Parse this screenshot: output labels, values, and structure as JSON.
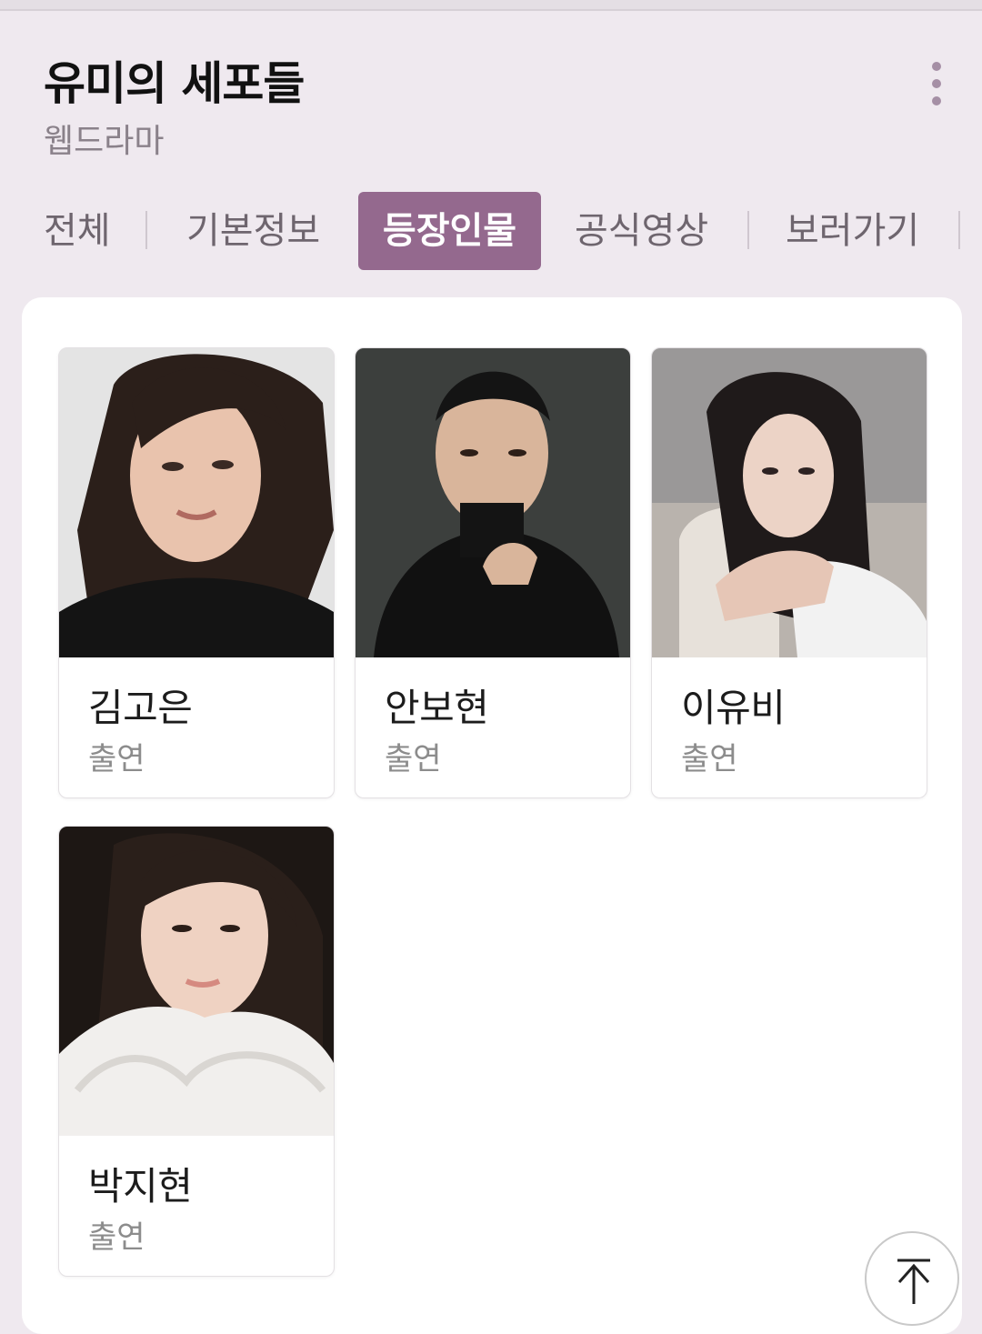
{
  "header": {
    "title": "유미의 세포들",
    "subtitle": "웹드라마"
  },
  "tabs": [
    {
      "label": "전체"
    },
    {
      "label": "기본정보"
    },
    {
      "label": "등장인물"
    },
    {
      "label": "공식영상"
    },
    {
      "label": "보러가기"
    }
  ],
  "cast": [
    {
      "name": "김고은",
      "role": "출연"
    },
    {
      "name": "안보현",
      "role": "출연"
    },
    {
      "name": "이유비",
      "role": "출연"
    },
    {
      "name": "박지현",
      "role": "출연"
    }
  ],
  "icons": {
    "more": "more-vertical-icon",
    "scroll_top": "arrow-up-to-top-icon"
  },
  "colors": {
    "accent": "#94698e",
    "page_bg": "#efe9ef"
  }
}
